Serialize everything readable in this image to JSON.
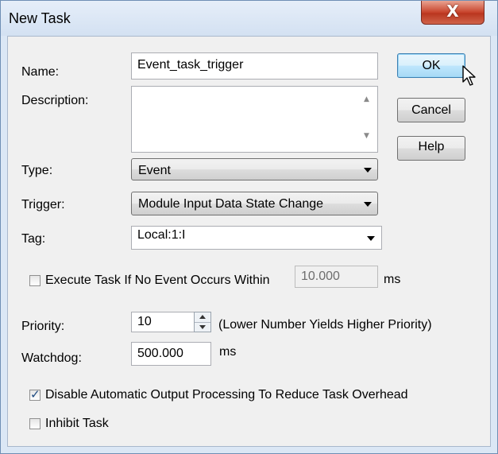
{
  "window": {
    "title": "New Task",
    "close_glyph": "X"
  },
  "form": {
    "name_label": "Name:",
    "name_value": "Event_task_trigger",
    "description_label": "Description:",
    "description_value": "",
    "type_label": "Type:",
    "type_value": "Event",
    "trigger_label": "Trigger:",
    "trigger_value": "Module Input Data State Change",
    "tag_label": "Tag:",
    "tag_value": "Local:1:I",
    "execute_label": "Execute Task If No Event Occurs Within",
    "execute_checked": false,
    "execute_value": "10.000",
    "execute_unit": "ms",
    "priority_label": "Priority:",
    "priority_value": "10",
    "priority_hint": "(Lower Number Yields Higher Priority)",
    "watchdog_label": "Watchdog:",
    "watchdog_value": "500.000",
    "watchdog_unit": "ms",
    "disable_output_label": "Disable Automatic Output Processing To Reduce Task Overhead",
    "disable_output_checked": true,
    "inhibit_label": "Inhibit Task",
    "inhibit_checked": false
  },
  "buttons": {
    "ok": "OK",
    "cancel": "Cancel",
    "help": "Help"
  },
  "icons": {
    "close": "close-icon",
    "dropdown": "chevron-down-icon",
    "spinner_up": "arrow-up-icon",
    "spinner_down": "arrow-down-icon",
    "cursor": "mouse-pointer-icon"
  },
  "colors": {
    "title_bar": "#dbe7f5",
    "close_button": "#c8442c",
    "dialog_face": "#f0f0f0",
    "default_button": "#bee6fd"
  }
}
